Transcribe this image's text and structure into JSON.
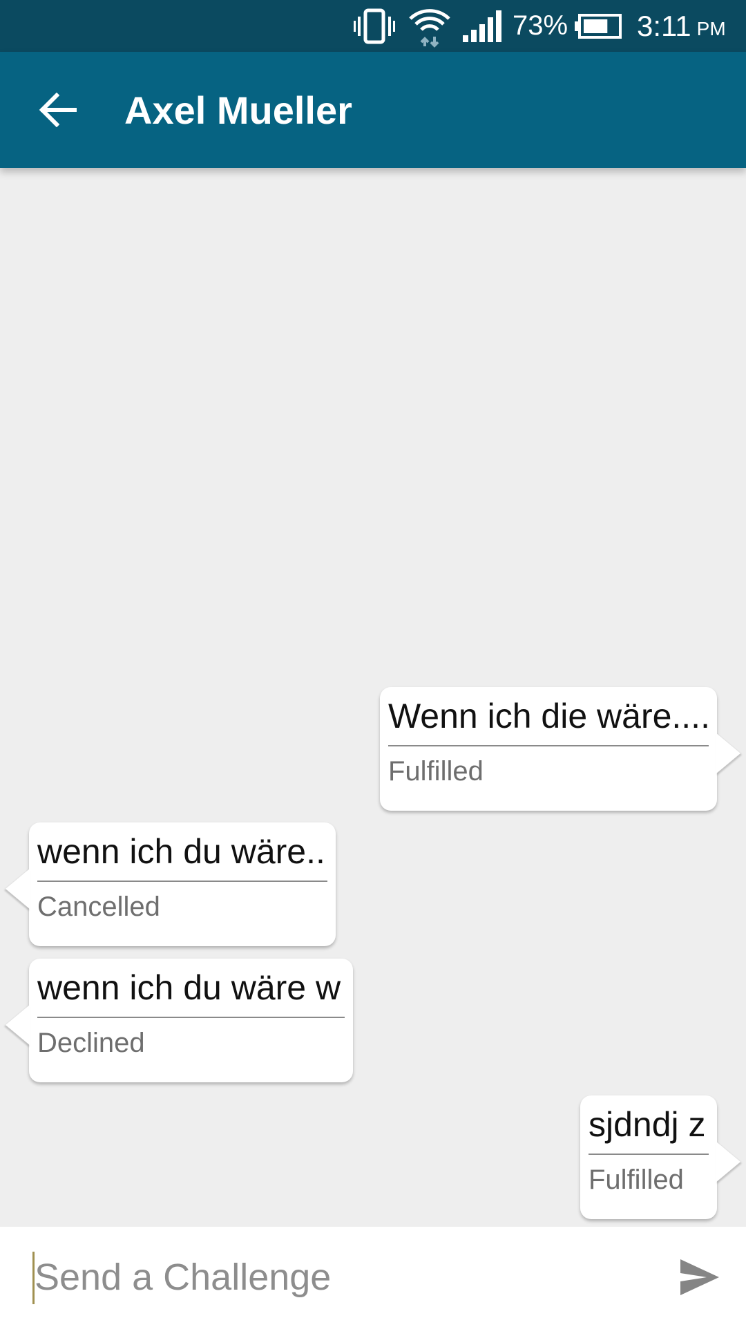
{
  "status_bar": {
    "battery_percent_label": "73%",
    "battery_level": 0.73,
    "time": "3:11",
    "ampm": "PM",
    "icons": [
      "vibrate-icon",
      "wifi-icon",
      "signal-icon",
      "battery-icon"
    ]
  },
  "app_bar": {
    "back_icon": "arrow-left-icon",
    "title": "Axel Mueller"
  },
  "messages": [
    {
      "direction": "sent",
      "text": "Wenn ich die wäre....",
      "status": "Fulfilled"
    },
    {
      "direction": "received",
      "text": "wenn ich du wäre..",
      "status": "Cancelled"
    },
    {
      "direction": "received",
      "text": "wenn ich du wäre w",
      "status": "Declined"
    },
    {
      "direction": "sent",
      "text": "sjdndj z",
      "status": "Fulfilled"
    }
  ],
  "composer": {
    "placeholder": "Send a Challenge",
    "value": "",
    "send_icon": "send-icon"
  },
  "colors": {
    "status_bar": "#0b4a60",
    "app_bar": "#066382",
    "chat_background": "#eeeeee",
    "bubble": "#ffffff",
    "status_text": "#6e6e6e"
  }
}
